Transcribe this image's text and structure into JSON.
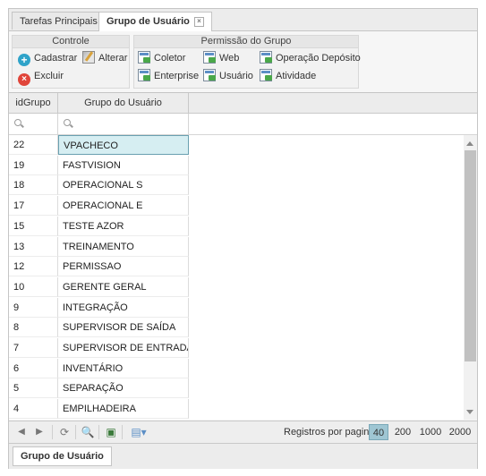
{
  "tabs": [
    {
      "label": "Tarefas Principais"
    },
    {
      "label": "Grupo de Usuário",
      "close": "×"
    }
  ],
  "ribbon": {
    "controle": {
      "title": "Controle",
      "cadastrar": "Cadastrar",
      "alterar": "Alterar",
      "excluir": "Excluir"
    },
    "permissao": {
      "title": "Permissão do Grupo",
      "coletor": "Coletor",
      "web": "Web",
      "operacao_deposito": "Operação Depósito",
      "enterprise": "Enterprise",
      "usuario": "Usuário",
      "atividade": "Atividade"
    }
  },
  "grid": {
    "columns": [
      "idGrupo",
      "Grupo do Usuário"
    ],
    "rows": [
      {
        "id": "22",
        "nome": "VPACHECO"
      },
      {
        "id": "19",
        "nome": "FASTVISION"
      },
      {
        "id": "18",
        "nome": "OPERACIONAL S"
      },
      {
        "id": "17",
        "nome": "OPERACIONAL E"
      },
      {
        "id": "15",
        "nome": "TESTE AZOR"
      },
      {
        "id": "13",
        "nome": "TREINAMENTO"
      },
      {
        "id": "12",
        "nome": "PERMISSAO"
      },
      {
        "id": "10",
        "nome": "GERENTE GERAL"
      },
      {
        "id": "9",
        "nome": "INTEGRAÇÃO"
      },
      {
        "id": "8",
        "nome": "SUPERVISOR DE SAÍDA"
      },
      {
        "id": "7",
        "nome": "SUPERVISOR DE ENTRADA"
      },
      {
        "id": "6",
        "nome": "INVENTÁRIO"
      },
      {
        "id": "5",
        "nome": "SEPARAÇÃO"
      },
      {
        "id": "4",
        "nome": "EMPILHADEIRA"
      }
    ]
  },
  "pager": {
    "label": "Registros por pagina:",
    "sizes": [
      "40",
      "200",
      "1000",
      "2000"
    ],
    "active": "40"
  },
  "bottom_tab": "Grupo de Usuário"
}
